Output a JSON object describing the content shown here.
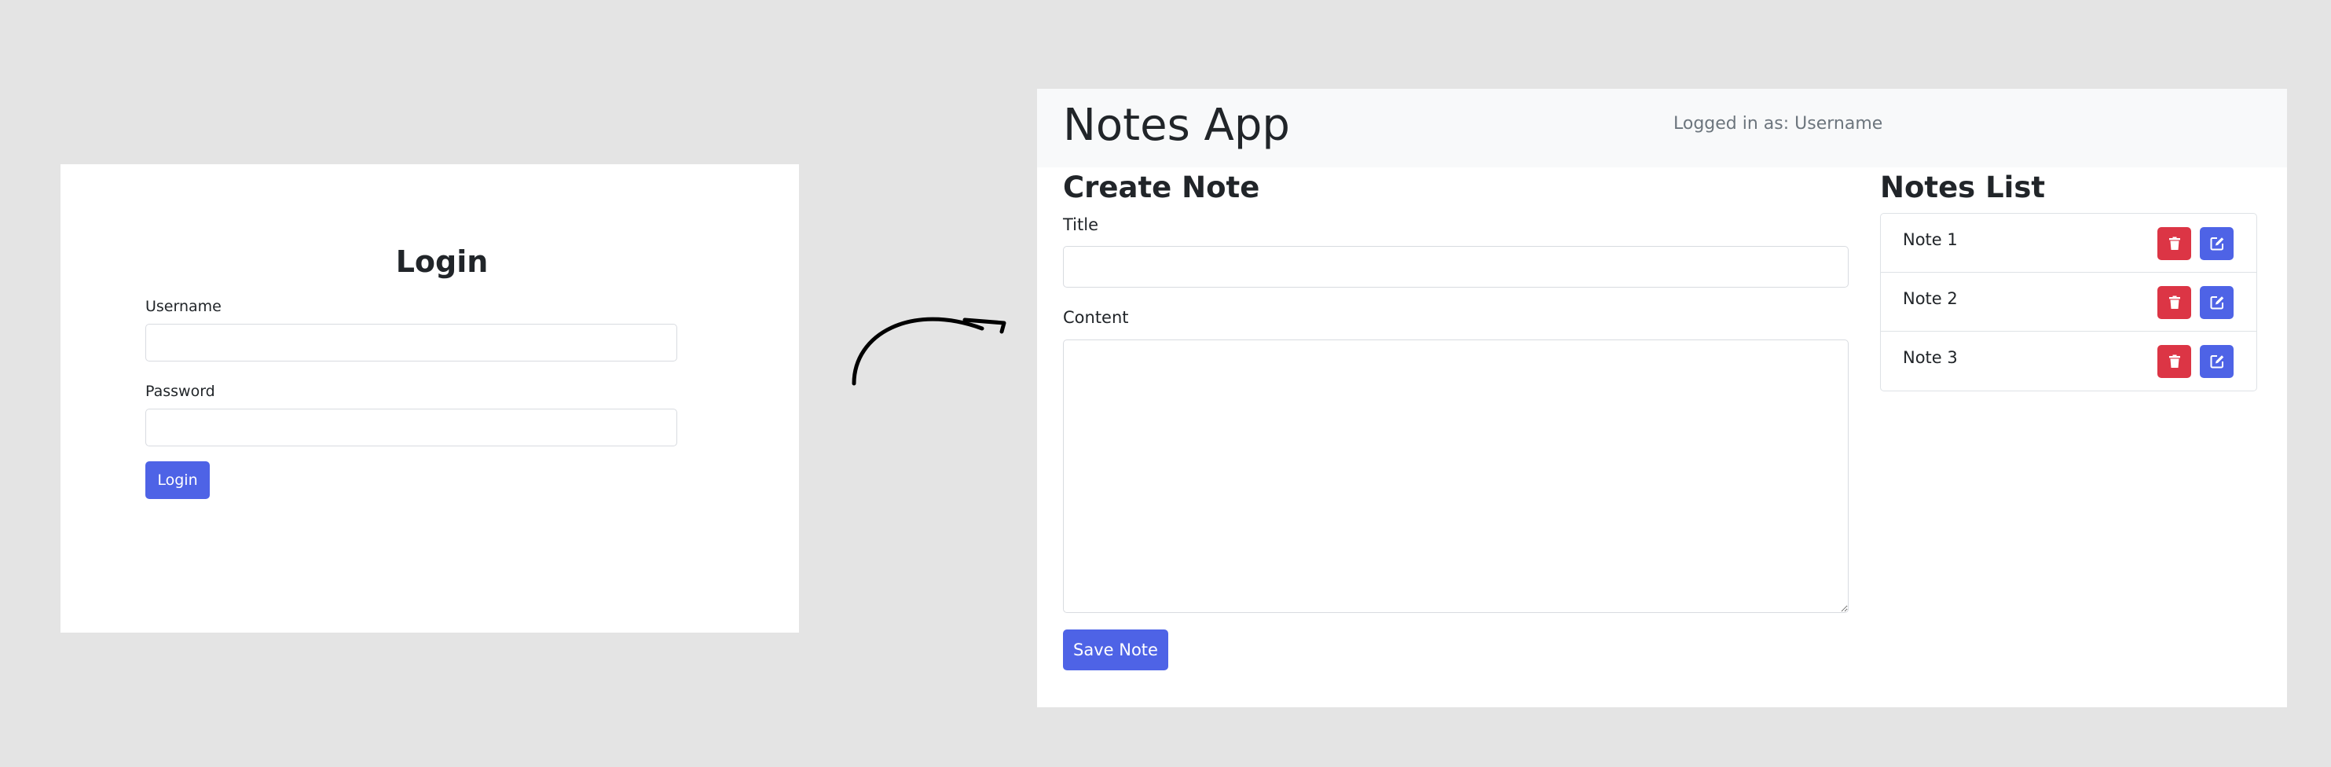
{
  "login": {
    "title": "Login",
    "username_label": "Username",
    "username_value": "",
    "password_label": "Password",
    "password_value": "",
    "login_button": "Login"
  },
  "app": {
    "title": "Notes App",
    "logged_in_text": "Logged in as: Username",
    "create_note": {
      "heading": "Create Note",
      "title_label": "Title",
      "title_value": "",
      "content_label": "Content",
      "content_value": "",
      "save_button": "Save Note"
    },
    "notes_list": {
      "heading": "Notes List",
      "items": [
        {
          "name": "Note 1",
          "delete_icon": "trash-icon",
          "edit_icon": "edit-icon"
        },
        {
          "name": "Note 2",
          "delete_icon": "trash-icon",
          "edit_icon": "edit-icon"
        },
        {
          "name": "Note 3",
          "delete_icon": "trash-icon",
          "edit_icon": "edit-icon"
        }
      ]
    }
  },
  "colors": {
    "background": "#e4e4e4",
    "primary": "#4e63e6",
    "danger": "#dc3545",
    "header_bg": "#f8f9fa",
    "muted_text": "#6c757d"
  }
}
